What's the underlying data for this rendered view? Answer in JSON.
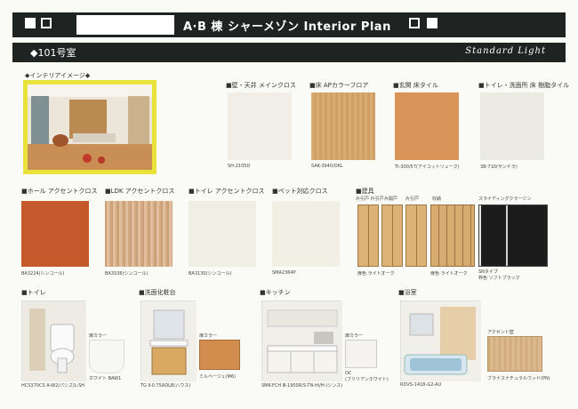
{
  "header": {
    "title": "A·B 棟 シャーメゾン Interior Plan"
  },
  "subbar": {
    "room": "◆101号室",
    "standard": "Standard Light"
  },
  "interior_image": {
    "label": "◆インテリアイメージ◆"
  },
  "finishes_row1": [
    {
      "label": "■壁・天井 メインクロス",
      "code": "SH-2105D"
    },
    {
      "label": "■床 APカラーフロア",
      "code": "SAK-3940/OKL"
    },
    {
      "label": "■玄関 床タイル",
      "code": "TI-300/57(アイコットリューク)"
    },
    {
      "label": "■トイレ・洗面所 床 樹脂タイル",
      "code": "3B-710(サンドラ)"
    }
  ],
  "finishes_row2": [
    {
      "label": "■ホール アクセントクロス",
      "code": "BA3224(シンコール)"
    },
    {
      "label": "■LDK アクセントクロス",
      "code": "BA3106(シンコール)"
    },
    {
      "label": "■トイレ アクセントクロス",
      "code": "BA3130(シンコール)"
    },
    {
      "label": "■ペット対応クロス",
      "code": "SMA2364P"
    }
  ],
  "fittings": {
    "label": "■建具",
    "door_labels": [
      "片引戸 片引戸",
      "片開戸",
      "片引戸",
      "収納",
      "スライディングクラージン"
    ],
    "color_left": "扉色 ライトオーク",
    "color_mid": "扉色 ライトオーク",
    "color_right": "SNタイプ",
    "color_right_sub": "枠色 ソフトブラック"
  },
  "toilet": {
    "label": "■トイレ",
    "door_color": "扉カラー",
    "code": "HCS370CS A-W2/パシズ/L-SH",
    "color": "ホワイト BAW1"
  },
  "vanity": {
    "label": "■洗面化粧台",
    "door_color": "扉カラー",
    "code": "TG Ⅱ-0.75ADLB(ハウス)",
    "color": "ミルベージュ(M6)"
  },
  "kitchen": {
    "label": "■キッチン",
    "door_color": "扉カラー",
    "code": "SMK-FCH Ⅲ-1950R/S-TN-Hi/H-(シンス)",
    "color": "OC",
    "color_sub": "(ブリリアンホワイト)"
  },
  "bath": {
    "label": "■浴室",
    "accent": "アクセント壁",
    "code": "RDVS-1418-G2-AU",
    "color": "ブラナスナチュラルウッド(PN)"
  }
}
